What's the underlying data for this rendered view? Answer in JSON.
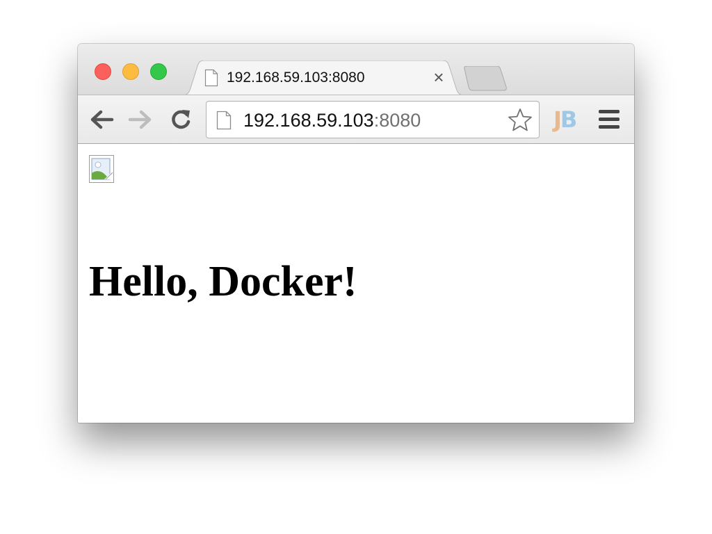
{
  "browser": {
    "tab": {
      "title": "192.168.59.103:8080",
      "close_glyph": "×"
    },
    "address_bar": {
      "host": "192.168.59.103",
      "port": ":8080"
    },
    "extension": {
      "letter_j": "J",
      "letter_b": "B"
    },
    "icons": {
      "back": "back-arrow-icon",
      "forward": "forward-arrow-icon",
      "reload": "reload-icon",
      "star": "bookmark-star-icon",
      "menu": "hamburger-menu-icon",
      "page": "page-icon",
      "broken_image": "broken-image-icon"
    },
    "colors": {
      "close": "#fc605c",
      "minimize": "#fdbc40",
      "maximize": "#34c84a",
      "ext_j": "#e9b98e",
      "ext_b": "#9fc7e6"
    }
  },
  "page": {
    "heading": "Hello, Docker!"
  }
}
